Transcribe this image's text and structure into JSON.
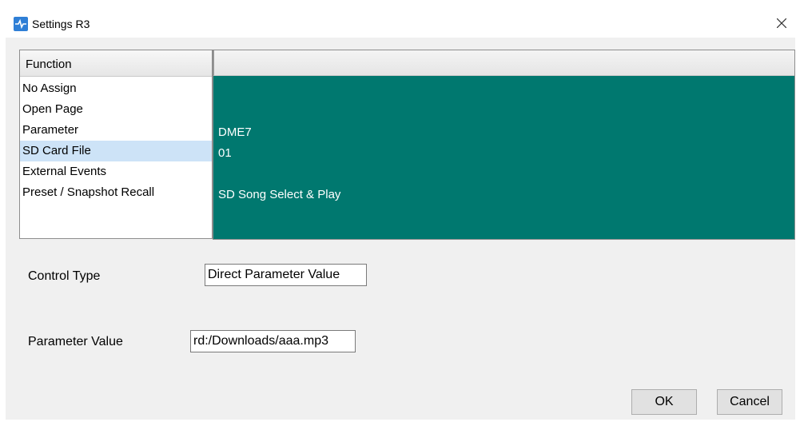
{
  "window": {
    "title": "Settings R3",
    "icon": "app-icon",
    "close_icon": "close-icon"
  },
  "function_list": {
    "header": "Function",
    "items": [
      {
        "label": "No Assign",
        "selected": false
      },
      {
        "label": "Open Page",
        "selected": false
      },
      {
        "label": "Parameter",
        "selected": false
      },
      {
        "label": "SD Card File",
        "selected": true
      },
      {
        "label": "External Events",
        "selected": false
      },
      {
        "label": "Preset / Snapshot Recall",
        "selected": false
      }
    ]
  },
  "detail": {
    "header": "",
    "lines": [
      "DME7",
      "01",
      "",
      "SD Song Select & Play"
    ],
    "background_color": "#00786f"
  },
  "control_type": {
    "label": "Control Type",
    "value": "Direct Parameter Value"
  },
  "parameter_value": {
    "label": "Parameter Value",
    "value": "rd:/Downloads/aaa.mp3"
  },
  "buttons": {
    "ok": "OK",
    "cancel": "Cancel"
  },
  "colors": {
    "selection": "#cde3f7",
    "detail_bg": "#00786f"
  }
}
